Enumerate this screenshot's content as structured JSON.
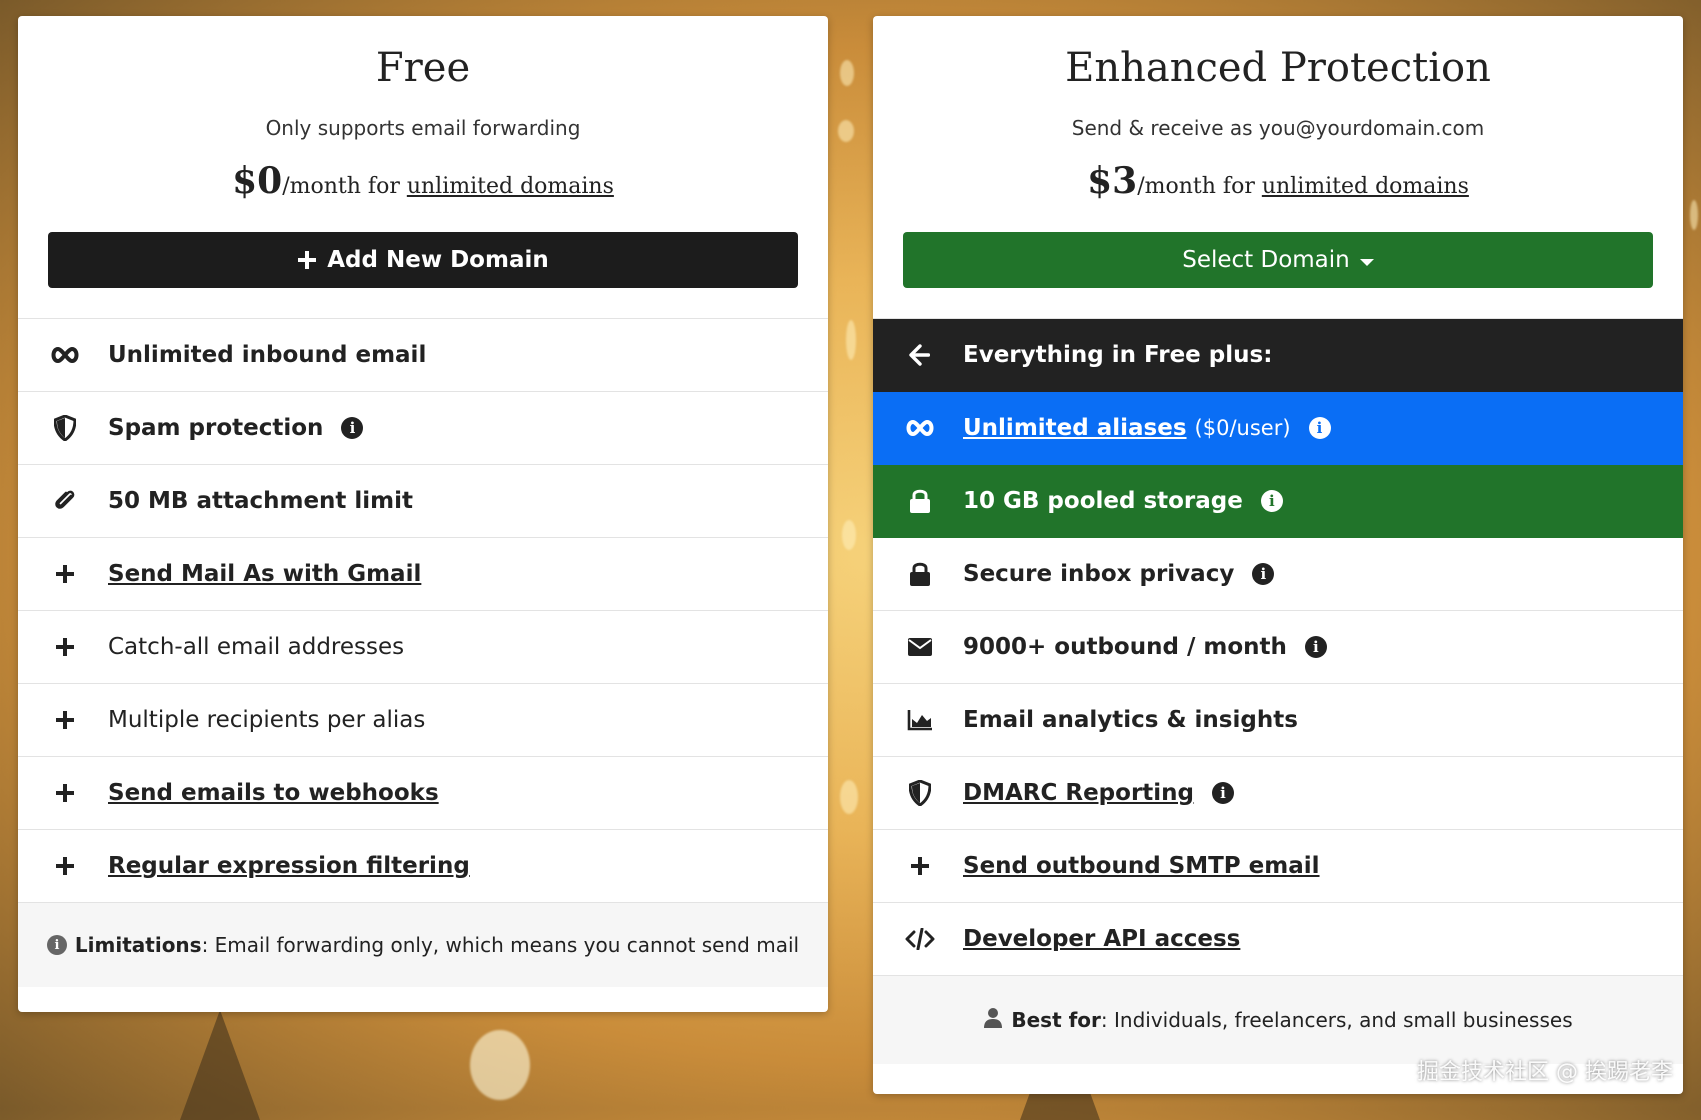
{
  "free_plan": {
    "title": "Free",
    "subtitle": "Only supports email forwarding",
    "price_amount": "$0",
    "price_period": "/month for ",
    "price_link": "unlimited domains",
    "cta_label": "Add New Domain",
    "features": [
      {
        "icon": "infinity-icon",
        "label": "Unlimited inbound email"
      },
      {
        "icon": "shield-icon",
        "label": "Spam protection",
        "info": "i"
      },
      {
        "icon": "paperclip-icon",
        "label": "50 MB attachment limit"
      },
      {
        "icon": "plus-icon",
        "label": "Send Mail As with Gmail"
      },
      {
        "icon": "plus-icon",
        "label": "Catch-all email addresses"
      },
      {
        "icon": "plus-icon",
        "label": "Multiple recipients per alias"
      },
      {
        "icon": "plus-icon",
        "label": "Send emails to webhooks"
      },
      {
        "icon": "plus-icon",
        "label": "Regular expression filtering"
      }
    ],
    "footer_icon": "i",
    "footer_bold": "Limitations",
    "footer_text": ": Email forwarding only, which means you cannot send mail"
  },
  "pro_plan": {
    "title": "Enhanced Protection",
    "subtitle": "Send & receive as you@yourdomain.com",
    "price_amount": "$3",
    "price_period": "/month for ",
    "price_link": "unlimited domains",
    "cta_label": "Select Domain",
    "header_row": "Everything in Free plus:",
    "features": [
      {
        "icon": "infinity-icon",
        "label": "Unlimited aliases",
        "aside": "($0/user)",
        "info": "i"
      },
      {
        "icon": "lock-icon",
        "label": "10 GB pooled storage",
        "info": "i"
      },
      {
        "icon": "lock-icon",
        "label": "Secure inbox privacy",
        "info": "i"
      },
      {
        "icon": "envelope-icon",
        "label": "9000+ outbound / month",
        "info": "i"
      },
      {
        "icon": "area-chart-icon",
        "label": "Email analytics & insights"
      },
      {
        "icon": "shield-icon",
        "label": "DMARC Reporting",
        "info": "i"
      },
      {
        "icon": "plus-icon",
        "label": "Send outbound SMTP email"
      },
      {
        "icon": "code-icon",
        "label": "Developer API access"
      }
    ],
    "footer_bold": "Best for",
    "footer_text": ": Individuals, freelancers, and small businesses"
  },
  "watermark": "掘金技术社区 @ 挨踢老李",
  "colors": {
    "dark": "#1c1c1c",
    "green": "#21742a",
    "blue": "#0a6ef5"
  }
}
